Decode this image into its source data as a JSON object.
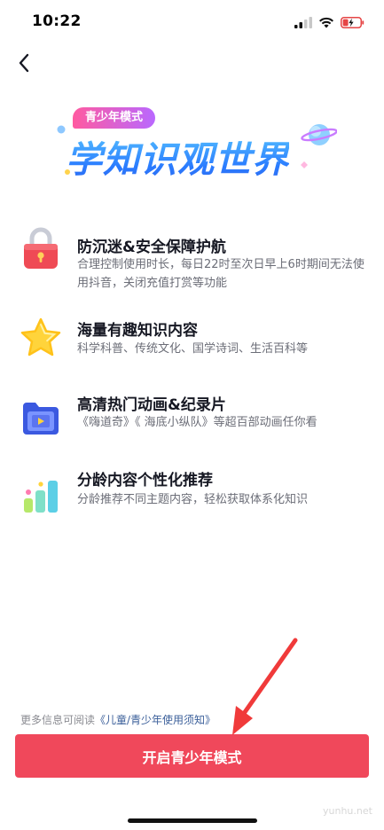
{
  "status_bar": {
    "time": "10:22",
    "icons": [
      "signal-icon",
      "wifi-icon",
      "battery-charging-icon"
    ],
    "battery_color": "#e64545"
  },
  "nav": {
    "back_icon": "chevron-left-icon"
  },
  "hero": {
    "badge": "青少年模式",
    "title": "学知识观世界",
    "badge_colors": [
      "#ff5aa0",
      "#b968ff"
    ],
    "title_color": "#2a7bff"
  },
  "features": [
    {
      "icon": "lock-icon",
      "title": "防沉迷&安全保障护航",
      "desc": "合理控制使用时长，每日22时至次日早上6时期间无法使用抖音，关闭充值打赏等功能"
    },
    {
      "icon": "star-icon",
      "title": "海量有趣知识内容",
      "desc": "科学科普、传统文化、国学诗词、生活百科等"
    },
    {
      "icon": "video-folder-icon",
      "title": "高清热门动画&纪录片",
      "desc": "《嗨道奇》《 海底小纵队》等超百部动画任你看"
    },
    {
      "icon": "bar-chart-icon",
      "title": "分龄内容个性化推荐",
      "desc": "分龄推荐不同主题内容，轻松获取体系化知识"
    }
  ],
  "footer": {
    "info_prefix": "更多信息可阅读",
    "info_link": "《儿童/青少年使用须知》",
    "button_label": "开启青少年模式",
    "button_color": "#f0485b"
  },
  "watermark": "yunhu.net"
}
